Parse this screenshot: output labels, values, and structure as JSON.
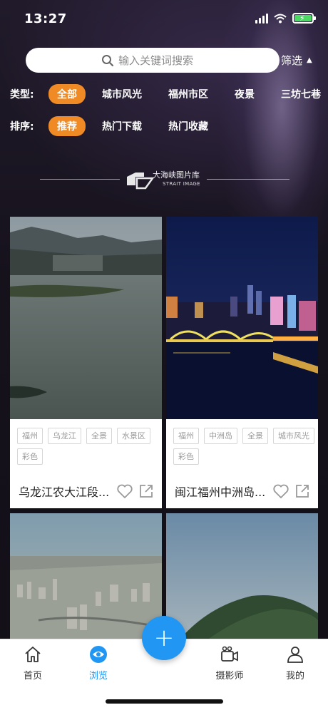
{
  "status_bar": {
    "time": "13:27"
  },
  "search": {
    "placeholder": "输入关键词搜索",
    "filter_label": "筛选"
  },
  "type_filter": {
    "label": "类型:",
    "options": [
      "全部",
      "城市风光",
      "福州市区",
      "夜景",
      "三坊七巷"
    ],
    "selected": "全部"
  },
  "sort_filter": {
    "label": "排序:",
    "options": [
      "推荐",
      "热门下载",
      "热门收藏"
    ],
    "selected": "推荐"
  },
  "brand": {
    "name_cn": "大海峡图片库",
    "name_en": "STRAIT IMAGE"
  },
  "cards": [
    {
      "tags": [
        "福州",
        "乌龙江",
        "全景",
        "水景区",
        "彩色"
      ],
      "title": "乌龙江农大江段..."
    },
    {
      "tags": [
        "福州",
        "中洲岛",
        "全景",
        "城市风光",
        "彩色"
      ],
      "title": "闽江福州中洲岛..."
    }
  ],
  "tabbar": {
    "items": [
      {
        "label": "首页",
        "icon": "home-icon"
      },
      {
        "label": "浏览",
        "icon": "eye-icon"
      },
      {
        "label": "摄影师",
        "icon": "video-camera-icon"
      },
      {
        "label": "我的",
        "icon": "user-icon"
      }
    ],
    "active": "浏览",
    "fab_label": "+"
  },
  "colors": {
    "accent": "#f08a24",
    "primary": "#2196f3"
  }
}
